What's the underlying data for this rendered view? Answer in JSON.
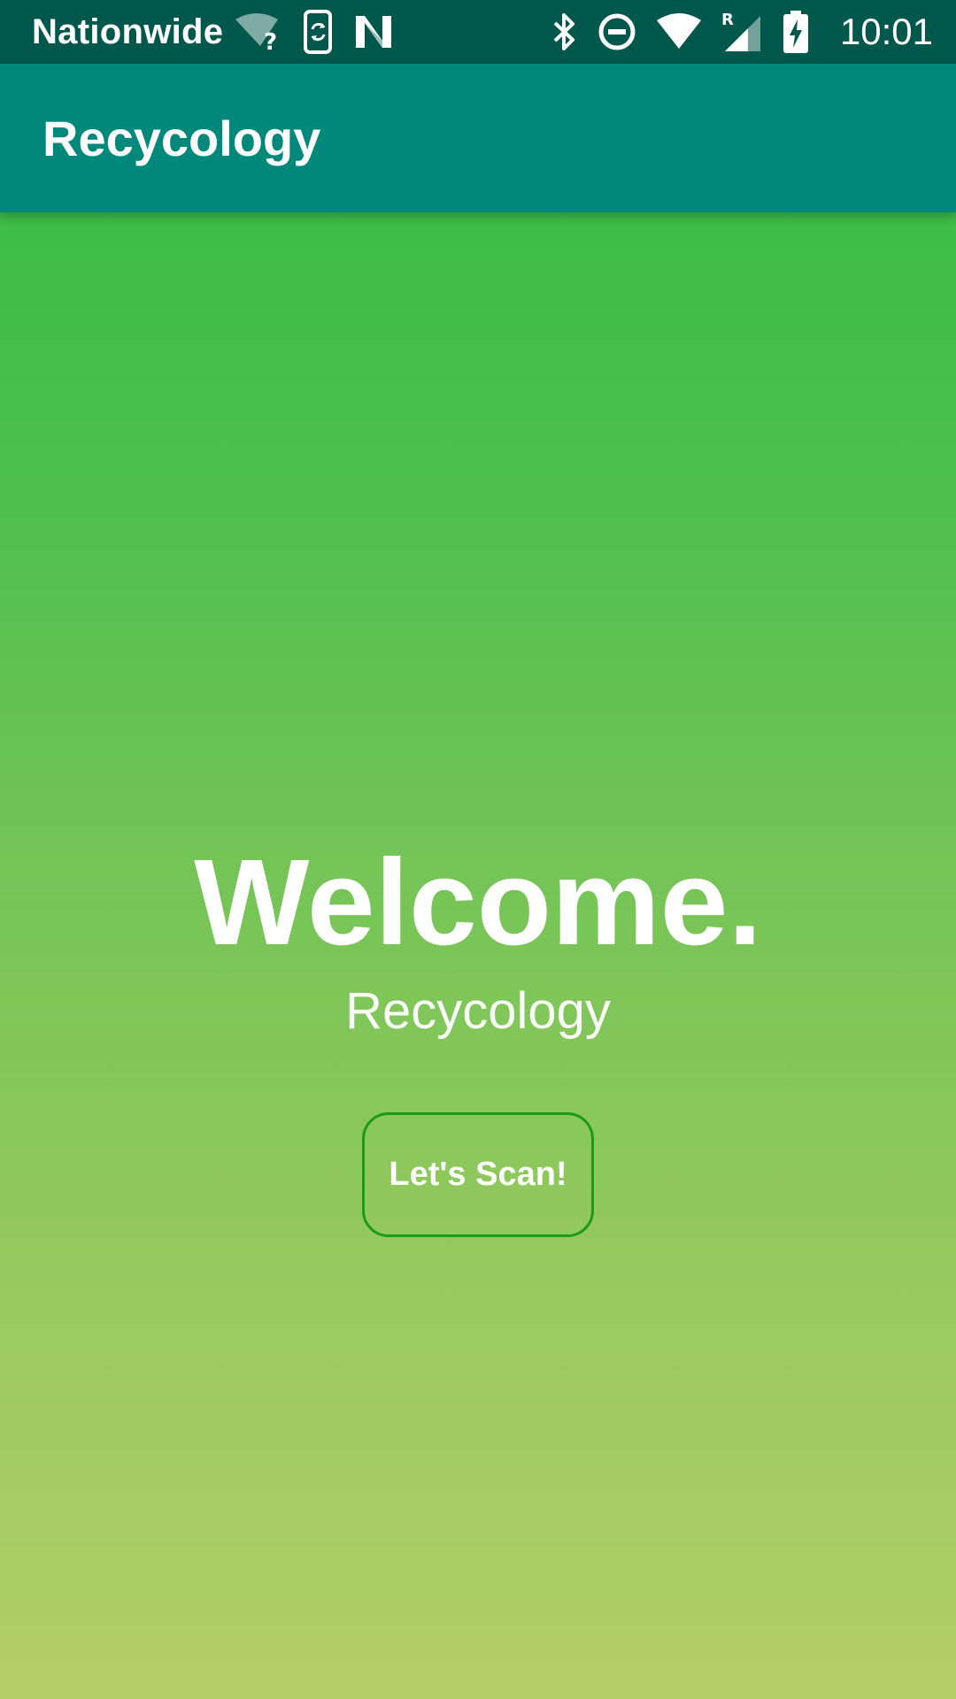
{
  "status_bar": {
    "carrier": "Nationwide",
    "time": "10:01",
    "network_type": "R",
    "icons": [
      "wifi-question-icon",
      "phone-sync-icon",
      "n-logo-icon",
      "bluetooth-icon",
      "do-not-disturb-icon",
      "wifi-icon",
      "cell-signal-icon",
      "battery-charging-icon"
    ]
  },
  "app_bar": {
    "title": "Recycology"
  },
  "main": {
    "heading": "Welcome.",
    "subtitle": "Recycology",
    "scan_button_label": "Let's Scan!"
  },
  "colors": {
    "status_bar": "#00574b",
    "app_bar": "#00897b",
    "gradient_top": "#2fbb42",
    "gradient_bottom": "#b4cf66",
    "button_border": "#1a9b16"
  }
}
